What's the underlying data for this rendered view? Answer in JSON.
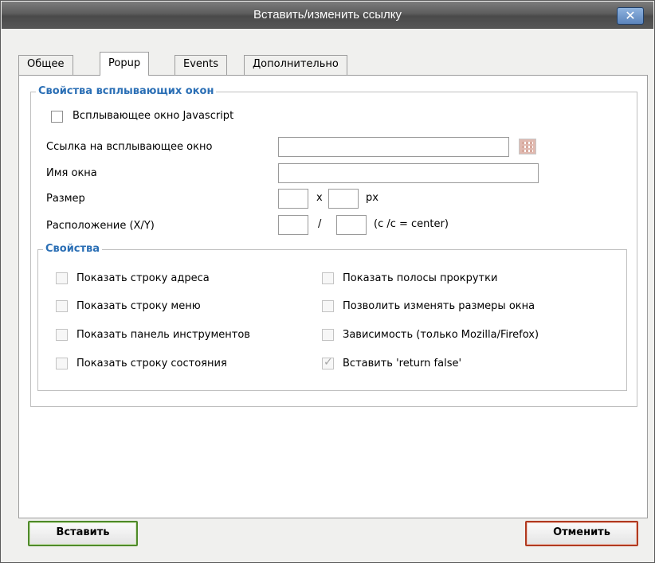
{
  "dialog": {
    "title": "Вставить/изменить ссылку",
    "close_glyph": "✕"
  },
  "tabs": [
    {
      "label": "Общее",
      "active": false
    },
    {
      "label": "Popup",
      "active": true
    },
    {
      "label": "Events",
      "active": false
    },
    {
      "label": "Дополнительно",
      "active": false
    }
  ],
  "popup_group": {
    "legend": "Свойства всплывающих окон",
    "js_popup_label": "Всплывающее окно Javascript",
    "js_popup_checked": false,
    "url_label": "Ссылка на всплывающее окно",
    "url_value": "",
    "name_label": "Имя окна",
    "name_value": "",
    "size_label": "Размер",
    "size_width": "",
    "size_sep": "x",
    "size_height": "",
    "size_unit": "px",
    "position_label": "Расположение (X/Y)",
    "position_x": "",
    "position_sep": "/",
    "position_y": "",
    "position_hint": "(c /c = center)"
  },
  "props_group": {
    "legend": "Свойства",
    "options": [
      {
        "label": "Показать строку адреса",
        "checked": false
      },
      {
        "label": "Показать полосы прокрутки",
        "checked": false
      },
      {
        "label": "Показать строку меню",
        "checked": false
      },
      {
        "label": "Позволить изменять размеры окна",
        "checked": false
      },
      {
        "label": "Показать панель инструментов",
        "checked": false
      },
      {
        "label": "Зависимость (только Mozilla/Firefox)",
        "checked": false
      },
      {
        "label": "Показать строку состояния",
        "checked": false
      },
      {
        "label": "Вставить 'return false'",
        "checked": true
      }
    ]
  },
  "buttons": {
    "insert": "Вставить",
    "cancel": "Отменить"
  },
  "colors": {
    "legend": "#2b6fb5",
    "insert_border": "#4f8a2a",
    "cancel_border": "#b03a20"
  }
}
